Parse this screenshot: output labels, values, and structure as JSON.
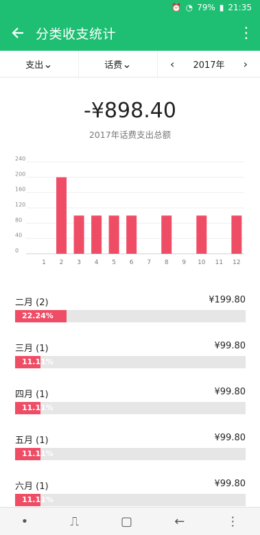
{
  "status_bar": {
    "battery": "79%",
    "time": "21:35"
  },
  "app_bar": {
    "title": "分类收支统计"
  },
  "filters": {
    "type": "支出",
    "category": "话费",
    "year": "2017年"
  },
  "summary": {
    "total": "-¥898.40",
    "caption": "2017年话费支出总额"
  },
  "chart_data": {
    "type": "bar",
    "categories": [
      "1",
      "2",
      "3",
      "4",
      "5",
      "6",
      "7",
      "8",
      "9",
      "10",
      "11",
      "12"
    ],
    "values": [
      0,
      199.8,
      99.8,
      99.8,
      99.8,
      99.8,
      0,
      99.8,
      0,
      99.8,
      0,
      99.8
    ],
    "yticks": [
      "0",
      "40",
      "80",
      "120",
      "160",
      "200",
      "240"
    ],
    "ylim": [
      0,
      240
    ],
    "grid": true,
    "bar_color": "#ef4d66"
  },
  "months": [
    {
      "label": "二月 (2)",
      "amount": "¥199.80",
      "percent": "22.24%",
      "fraction": 0.2224
    },
    {
      "label": "三月 (1)",
      "amount": "¥99.80",
      "percent": "11.11%",
      "fraction": 0.1111
    },
    {
      "label": "四月 (1)",
      "amount": "¥99.80",
      "percent": "11.11%",
      "fraction": 0.1111
    },
    {
      "label": "五月 (1)",
      "amount": "¥99.80",
      "percent": "11.11%",
      "fraction": 0.1111
    },
    {
      "label": "六月 (1)",
      "amount": "¥99.80",
      "percent": "11.11%",
      "fraction": 0.1111
    }
  ],
  "colors": {
    "primary": "#1fbf73",
    "accent": "#ef4d66"
  }
}
